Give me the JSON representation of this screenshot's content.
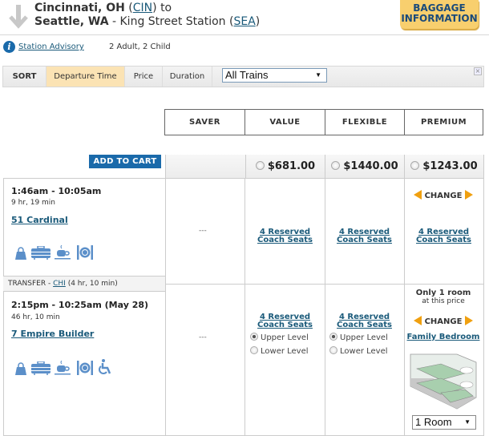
{
  "route": {
    "origin_city": "Cincinnati, OH",
    "origin_code": "CIN",
    "to_word": "to",
    "destination_city": "Seattle, WA",
    "destination_station": "King Street Station",
    "destination_code": "SEA"
  },
  "baggage_button": {
    "line1": "BAGGAGE",
    "line2": "INFORMATION"
  },
  "subheader": {
    "advisory_link": "Station Advisory",
    "passengers": "2 Adult, 2 Child"
  },
  "sortbar": {
    "label": "SORT",
    "options": [
      {
        "label": "Departure Time",
        "active": true
      },
      {
        "label": "Price",
        "active": false
      },
      {
        "label": "Duration",
        "active": false
      }
    ],
    "train_filter": "All Trains",
    "close_symbol": "×"
  },
  "fares": {
    "headers": [
      "SAVER",
      "VALUE",
      "FLEXIBLE",
      "PREMIUM"
    ],
    "add_to_cart": "ADD TO CART",
    "prices": {
      "saver": "",
      "value": "$681.00",
      "flexible": "$1440.00",
      "premium": "$1243.00"
    }
  },
  "legs": [
    {
      "times": "1:46am - 10:05am",
      "duration": "9 hr, 19 min",
      "train": "51 Cardinal",
      "amenities": [
        "shopping-bag",
        "luggage",
        "cafe",
        "dining"
      ],
      "saver": "---",
      "value": {
        "seats": "4 Reserved Coach Seats"
      },
      "flexible": {
        "seats": "4 Reserved Coach Seats"
      },
      "premium": {
        "change": "CHANGE",
        "seats": "4 Reserved Coach Seats"
      }
    },
    {
      "times": "2:15pm - 10:25am (May 28)",
      "duration": "46 hr, 10 min",
      "train": "7 Empire Builder",
      "amenities": [
        "shopping-bag",
        "luggage",
        "cafe",
        "dining",
        "accessible"
      ],
      "saver": "---",
      "value": {
        "seats": "4 Reserved Coach Seats",
        "levels": [
          {
            "label": "Upper Level",
            "checked": true
          },
          {
            "label": "Lower Level",
            "checked": false
          }
        ]
      },
      "flexible": {
        "seats": "4 Reserved Coach Seats",
        "levels": [
          {
            "label": "Upper Level",
            "checked": true
          },
          {
            "label": "Lower Level",
            "checked": false
          }
        ]
      },
      "premium": {
        "only_room_bold": "Only 1 room",
        "only_room_rest": "at this price",
        "change": "CHANGE",
        "room_type": "Family Bedroom",
        "room_count": "1 Room"
      }
    }
  ],
  "transfer": {
    "label": "TRANSFER -",
    "code": "CHI",
    "duration": "(4 hr, 10 min)"
  },
  "colors": {
    "accent_blue": "#1a6aaa",
    "link": "#1a5a7a",
    "orange": "#f0a010",
    "baggage": "#f8cf6e",
    "sort_active": "#fbe3b4"
  }
}
